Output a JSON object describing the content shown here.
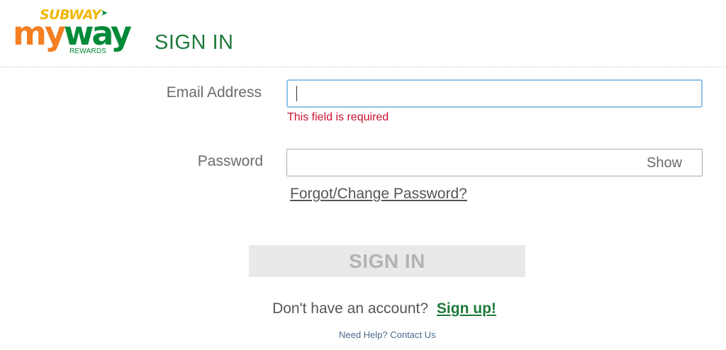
{
  "brand": {
    "subway_text": "SUBWAY",
    "my_text": "my",
    "way_text": "way",
    "rewards_text": "REWARDS",
    "colors": {
      "orange": "#f47e22",
      "green": "#008938",
      "yellow": "#f2b705"
    }
  },
  "header": {
    "title": "SIGN IN"
  },
  "form": {
    "email": {
      "label": "Email Address",
      "value": "",
      "placeholder": "",
      "error": "This field is required"
    },
    "password": {
      "label": "Password",
      "value": "",
      "show_label": "Show"
    },
    "forgot_link": "Forgot/Change Password?",
    "submit_label": "SIGN IN",
    "no_account_text": "Don't have an account?",
    "signup_link": "Sign up!",
    "help_link": "Need Help? Contact Us"
  },
  "colors": {
    "title_green": "#1f7a3a",
    "error_red": "#c8102e",
    "focus_border": "#8fc3e8",
    "button_disabled_bg": "#e9e9e9"
  },
  "icons": [
    "subway-myway-rewards-logo"
  ]
}
